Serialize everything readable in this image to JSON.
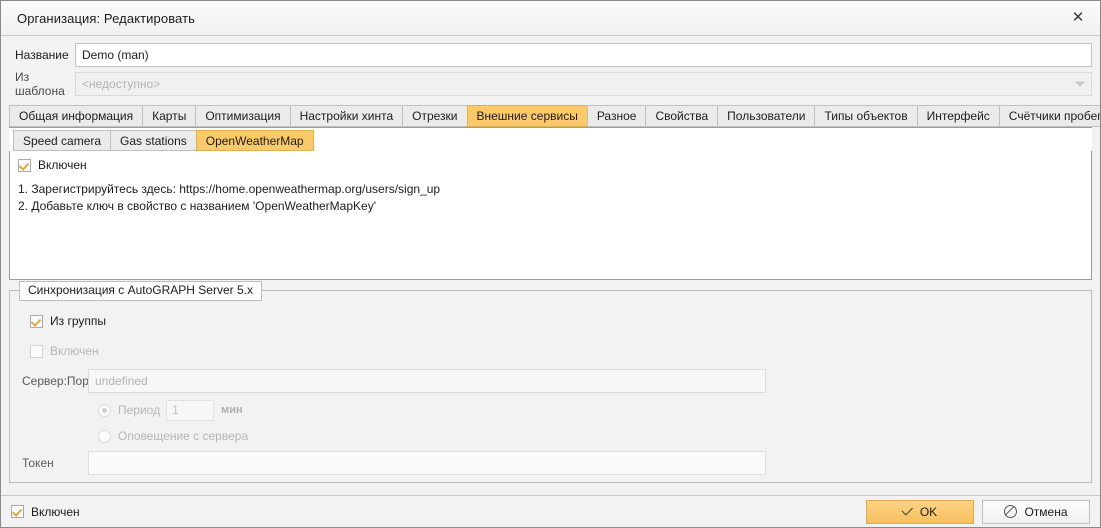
{
  "window": {
    "title": "Организация: Редактировать",
    "close_icon": "close-icon"
  },
  "header_fields": {
    "name_label": "Название",
    "name_value": "Demo (man)",
    "template_label": "Из шаблона",
    "template_value": "<недоступно>"
  },
  "main_tabs": [
    {
      "label": "Общая информация",
      "active": false
    },
    {
      "label": "Карты",
      "active": false
    },
    {
      "label": "Оптимизация",
      "active": false
    },
    {
      "label": "Настройки хинта",
      "active": false
    },
    {
      "label": "Отрезки",
      "active": false
    },
    {
      "label": "Внешние сервисы",
      "active": true
    },
    {
      "label": "Разное",
      "active": false
    },
    {
      "label": "Свойства",
      "active": false
    },
    {
      "label": "Пользователи",
      "active": false
    },
    {
      "label": "Типы объектов",
      "active": false
    },
    {
      "label": "Интерфейс",
      "active": false
    },
    {
      "label": "Счётчики пробега и моточасов",
      "active": false
    }
  ],
  "sub_tabs": [
    {
      "label": "Speed camera",
      "active": false
    },
    {
      "label": "Gas stations",
      "active": false
    },
    {
      "label": "OpenWeatherMap",
      "active": true
    }
  ],
  "service": {
    "enabled_label": "Включен",
    "enabled_checked": true,
    "instruction_1": "1. Зарегистрируйтесь здесь: https://home.openweathermap.org/users/sign_up",
    "instruction_2": "2. Добавьте ключ в свойство с названием 'OpenWeatherMapKey'"
  },
  "sync_group": {
    "title": "Синхронизация с AutoGRAPH Server 5.x",
    "from_group_label": "Из группы",
    "from_group_checked": true,
    "enabled_label": "Включен",
    "enabled_checked": false,
    "server_port_label": "Сервер:Порт",
    "server_port_placeholder": "undefined",
    "server_port_value": "",
    "period_radio_label": "Период",
    "period_selected": true,
    "period_value": "1",
    "period_unit": "мин",
    "notify_radio_label": "Оповещение с сервера",
    "notify_selected": false,
    "token_label": "Токен",
    "token_value": ""
  },
  "footer": {
    "enabled_label": "Включен",
    "enabled_checked": true,
    "ok_label": "OK",
    "cancel_label": "Отмена"
  },
  "colors": {
    "accent": "#fcc96a",
    "accent_border": "#e0af4e",
    "check_mark": "#e8a33d"
  }
}
